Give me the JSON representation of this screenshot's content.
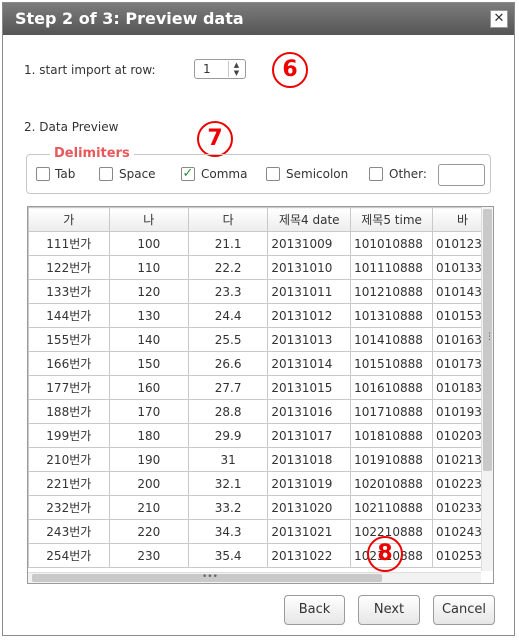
{
  "dialog": {
    "title": "Step 2 of 3: Preview data",
    "close_glyph": "✕"
  },
  "start_row": {
    "label": "1. start import at row:",
    "value": "1"
  },
  "callouts": {
    "six": "6",
    "seven": "7",
    "eight": "8"
  },
  "preview": {
    "label": "2. Data Preview"
  },
  "delimiters": {
    "legend": "Delimiters",
    "items": [
      {
        "label": "Tab",
        "checked": false
      },
      {
        "label": "Space",
        "checked": false
      },
      {
        "label": "Comma",
        "checked": true
      },
      {
        "label": "Semicolon",
        "checked": false
      },
      {
        "label": "Other:",
        "checked": false
      }
    ],
    "other_value": "",
    "check_color": "#2e8b3a"
  },
  "table": {
    "columns": [
      "가",
      "나",
      "다",
      "제목4 date",
      "제목5 time",
      "바"
    ],
    "rows": [
      [
        "111번가",
        "100",
        "21.1",
        "20131009",
        "101010888",
        "010123"
      ],
      [
        "122번가",
        "110",
        "22.2",
        "20131010",
        "101110888",
        "010133"
      ],
      [
        "133번가",
        "120",
        "23.3",
        "20131011",
        "101210888",
        "010143"
      ],
      [
        "144번가",
        "130",
        "24.4",
        "20131012",
        "101310888",
        "010153"
      ],
      [
        "155번가",
        "140",
        "25.5",
        "20131013",
        "101410888",
        "010163"
      ],
      [
        "166번가",
        "150",
        "26.6",
        "20131014",
        "101510888",
        "010173"
      ],
      [
        "177번가",
        "160",
        "27.7",
        "20131015",
        "101610888",
        "010183"
      ],
      [
        "188번가",
        "170",
        "28.8",
        "20131016",
        "101710888",
        "010193"
      ],
      [
        "199번가",
        "180",
        "29.9",
        "20131017",
        "101810888",
        "010203"
      ],
      [
        "210번가",
        "190",
        "31",
        "20131018",
        "101910888",
        "010213"
      ],
      [
        "221번가",
        "200",
        "32.1",
        "20131019",
        "102010888",
        "010223"
      ],
      [
        "232번가",
        "210",
        "33.2",
        "20131020",
        "102110888",
        "010233"
      ],
      [
        "243번가",
        "220",
        "34.3",
        "20131021",
        "102210888",
        "010243"
      ],
      [
        "254번가",
        "230",
        "35.4",
        "20131022",
        "102310888",
        "010253"
      ]
    ]
  },
  "buttons": {
    "back": "Back",
    "next": "Next",
    "cancel": "Cancel"
  },
  "colors": {
    "title_bg": "#666666",
    "callout": "#e00000",
    "legend": "#e8585a"
  }
}
